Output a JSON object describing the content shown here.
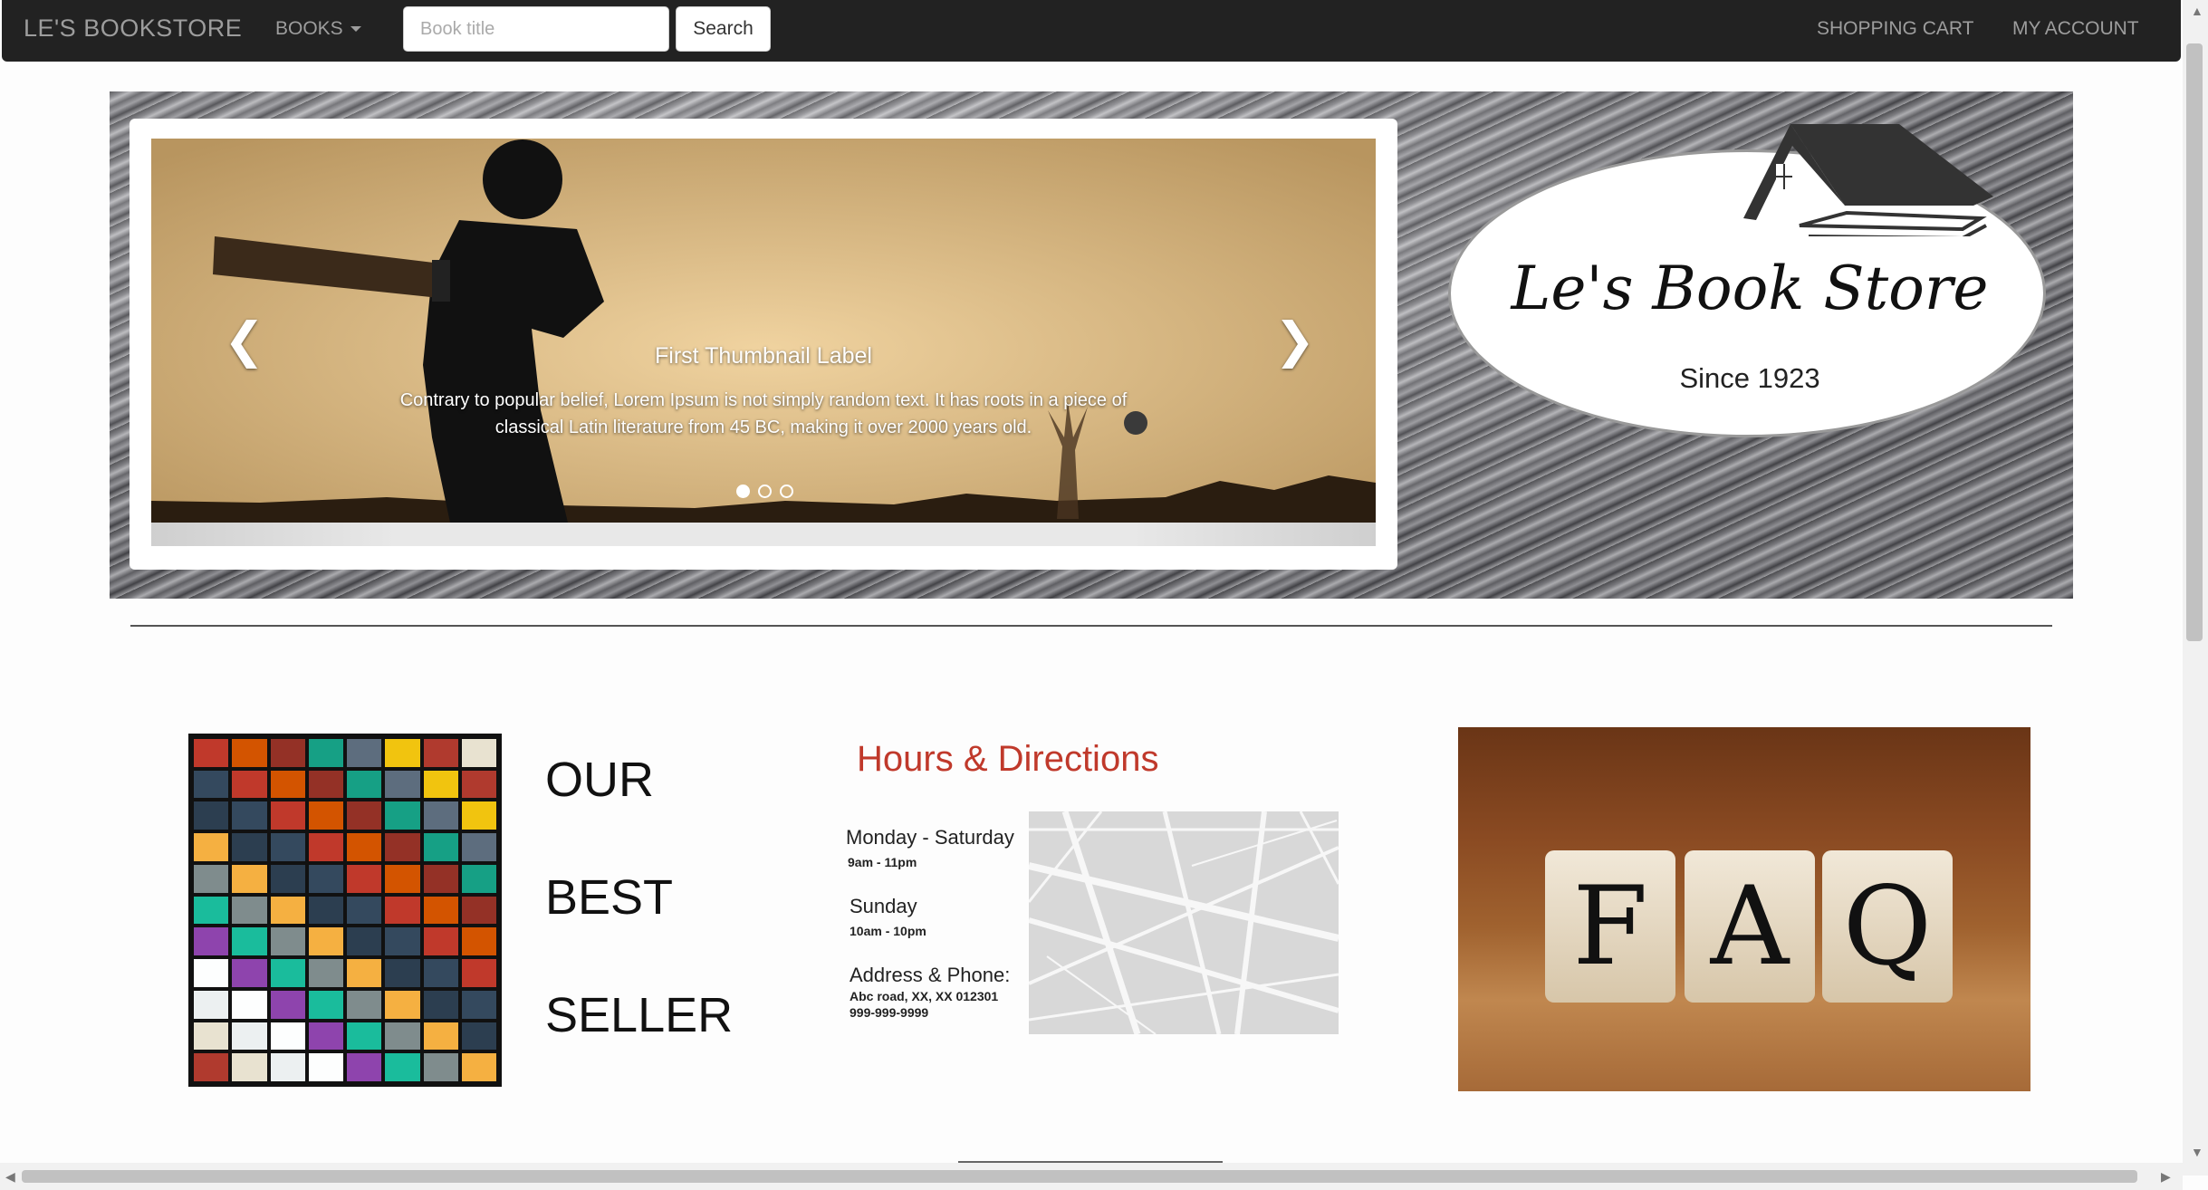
{
  "navbar": {
    "brand": "LE'S BOOKSTORE",
    "books_menu": "BOOKS",
    "search_placeholder": "Book title",
    "search_button": "Search",
    "cart": "SHOPPING CART",
    "account": "MY ACCOUNT"
  },
  "carousel": {
    "caption_title": "First Thumbnail Label",
    "caption_text": "Contrary to popular belief, Lorem Ipsum is not simply random text. It has roots in a piece of classical Latin literature from 45 BC, making it over 2000 years old.",
    "slide_count": 3,
    "active_slide": 1,
    "prev_icon": "chevron-left-icon",
    "next_icon": "chevron-right-icon"
  },
  "logo": {
    "name": "Le's Book Store",
    "since": "Since 1923"
  },
  "bestseller": {
    "words": [
      "OUR",
      "BEST",
      "SELLER"
    ]
  },
  "hours": {
    "title": "Hours & Directions",
    "weekday_label": "Monday - Saturday",
    "weekday_hours": "9am - 11pm",
    "sunday_label": "Sunday",
    "sunday_hours": "10am - 10pm",
    "address_label": "Address & Phone:",
    "address": "Abc road, XX, XX 012301",
    "phone": "999-999-9999"
  },
  "faq": {
    "letters": [
      "F",
      "A",
      "Q"
    ]
  },
  "colors": {
    "navbar": "#222222",
    "nav_text": "#9d9d9d",
    "accent_red": "#c0392b"
  }
}
